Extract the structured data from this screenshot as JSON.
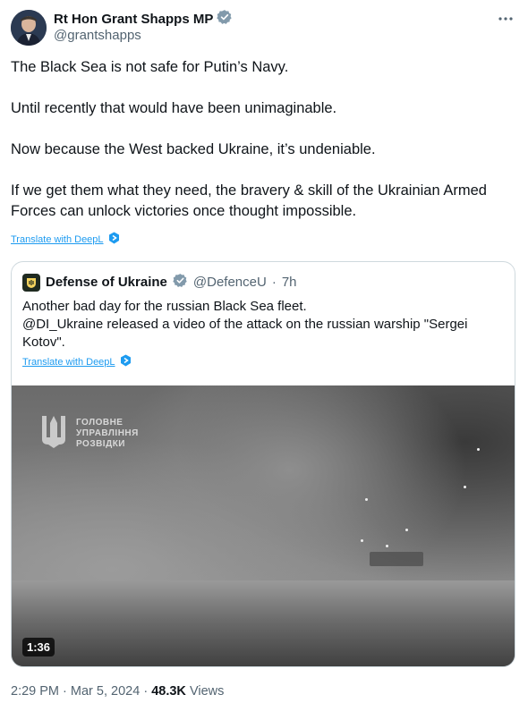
{
  "author": {
    "name": "Rt Hon Grant Shapps MP",
    "handle": "@grantshapps"
  },
  "tweet": {
    "paragraphs": [
      "The Black Sea is not safe for Putin’s Navy.",
      "Until recently that would have been unimaginable.",
      "Now because the West backed Ukraine, it’s undeniable.",
      "If we get them what they need, the bravery & skill of the Ukrainian Armed Forces can unlock victories once thought impossible."
    ],
    "translate_label": "Translate with DeepL"
  },
  "quoted": {
    "name": "Defense of Ukraine",
    "handle": "@DefenceU",
    "separator": "·",
    "time": "7h",
    "lines": [
      "Another bad day for the russian Black Sea fleet.",
      "@DI_Ukraine released a video of the attack on the russian warship \"Sergei Kotov\"."
    ],
    "translate_label": "Translate with DeepL",
    "video": {
      "watermark_lines": [
        "ГОЛОВНЕ",
        "УПРАВЛІННЯ",
        "РОЗВІДКИ"
      ],
      "duration": "1:36"
    }
  },
  "footer": {
    "time": "2:29 PM",
    "separator": "·",
    "date": "Mar 5, 2024",
    "views_count": "48.3K",
    "views_label": "Views"
  },
  "colors": {
    "verified": "#829aab",
    "link": "#1d9bf0",
    "secondary_text": "#536471",
    "border": "#cfd9de"
  },
  "icons": [
    "verified-badge-icon",
    "more-options-icon",
    "deepl-icon"
  ]
}
